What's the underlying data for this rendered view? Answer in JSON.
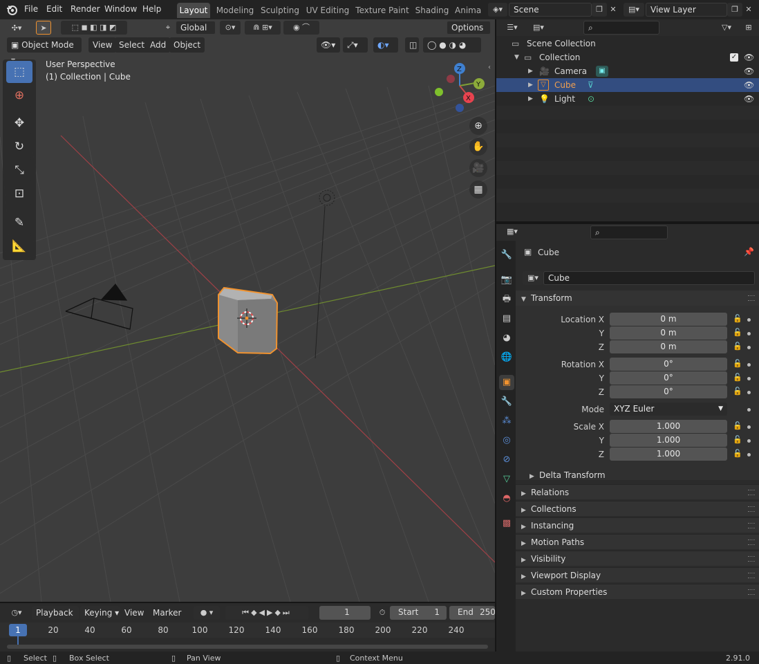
{
  "menu": [
    "File",
    "Edit",
    "Render",
    "Window",
    "Help"
  ],
  "workspaces": [
    "Layout",
    "Modeling",
    "Sculpting",
    "UV Editing",
    "Texture Paint",
    "Shading",
    "Anima"
  ],
  "scene": {
    "name": "Scene",
    "view_layer": "View Layer"
  },
  "viewport": {
    "transform_orientation": "Global",
    "options_label": "Options",
    "mode": "Object Mode",
    "header_menus": [
      "View",
      "Select",
      "Add",
      "Object"
    ],
    "overlay_title": "User Perspective",
    "overlay_subtitle": "(1) Collection | Cube",
    "gizmo_axes": [
      "Z",
      "Y",
      "X"
    ]
  },
  "timeline": {
    "menus": [
      "Playback",
      "Keying",
      "View",
      "Marker"
    ],
    "current_frame": "1",
    "start_label": "Start",
    "start_value": "1",
    "end_label": "End",
    "end_value": "250",
    "ticks": [
      "1",
      "20",
      "40",
      "60",
      "80",
      "100",
      "120",
      "140",
      "160",
      "180",
      "200",
      "220",
      "240"
    ]
  },
  "status": {
    "select": "Select",
    "box_select": "Box Select",
    "pan_view": "Pan View",
    "context_menu": "Context Menu",
    "version": "2.91.0"
  },
  "outliner": {
    "root": "Scene Collection",
    "collection": "Collection",
    "items": [
      {
        "label": "Camera"
      },
      {
        "label": "Cube"
      },
      {
        "label": "Light"
      }
    ]
  },
  "properties": {
    "object_name": "Cube",
    "object_field": "Cube",
    "transform_title": "Transform",
    "location": {
      "label": "Location X",
      "x": "0 m",
      "y": "0 m",
      "z": "0 m"
    },
    "rotation": {
      "label": "Rotation X",
      "x": "0°",
      "y": "0°",
      "z": "0°"
    },
    "mode_label": "Mode",
    "mode_value": "XYZ Euler",
    "scale": {
      "label": "Scale X",
      "x": "1.000",
      "y": "1.000",
      "z": "1.000"
    },
    "axis_y": "Y",
    "axis_z": "Z",
    "delta": "Delta Transform",
    "panels": [
      "Relations",
      "Collections",
      "Instancing",
      "Motion Paths",
      "Visibility",
      "Viewport Display",
      "Custom Properties"
    ]
  },
  "colors": {
    "accent": "#4772b3",
    "selection_orange": "#f0922f",
    "x_axis": "#c44a4a",
    "y_axis": "#7fa035",
    "z_axis": "#3f80d0",
    "header": "#232323",
    "viewport_bg": "#3d3d3d"
  }
}
